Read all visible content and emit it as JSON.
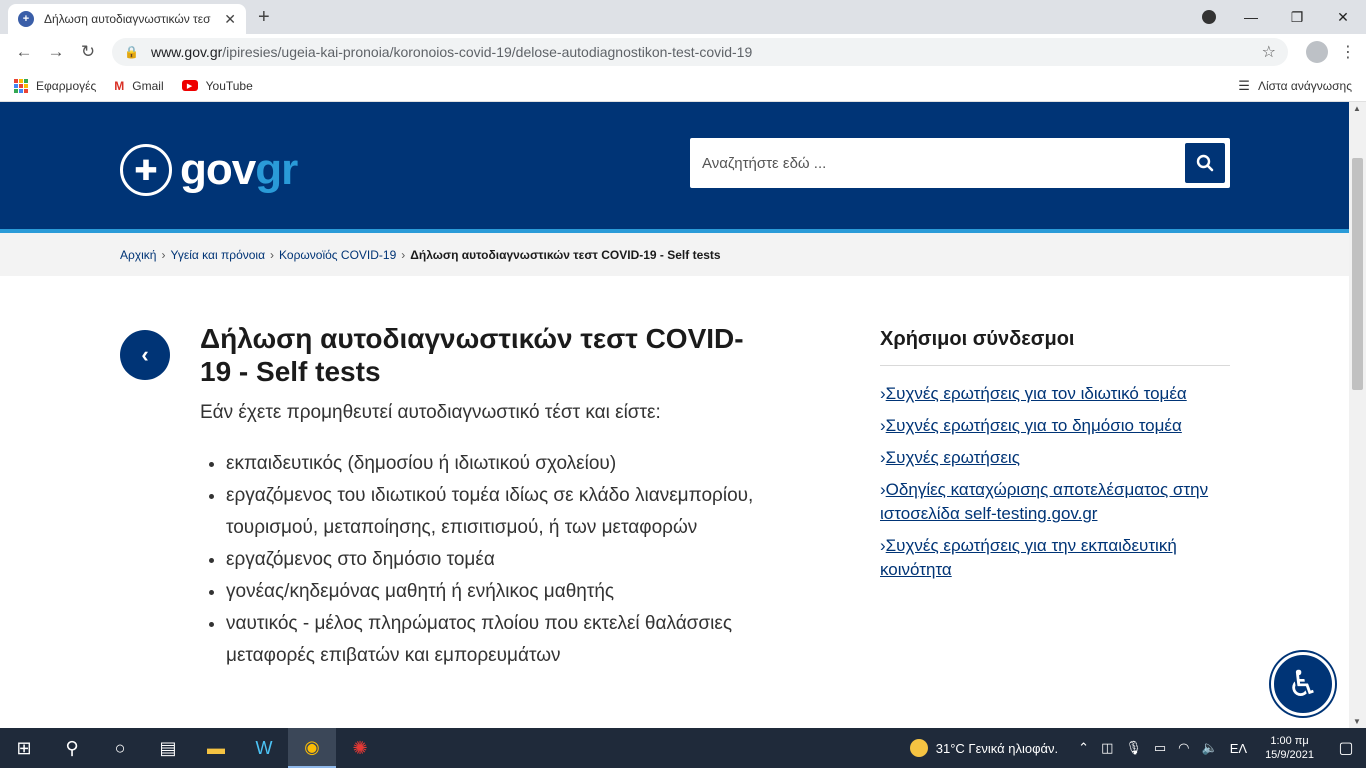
{
  "browser": {
    "tab_title": "Δήλωση αυτοδιαγνωστικών τεσ",
    "url_domain": "www.gov.gr",
    "url_path": "/ipiresies/ugeia-kai-pronoia/koronoios-covid-19/delose-autodiagnostikon-test-covid-19",
    "bookmarks": [
      "Εφαρμογές",
      "Gmail",
      "YouTube"
    ],
    "reading_list": "Λίστα ανάγνωσης"
  },
  "header": {
    "logo_gov": "gov",
    "logo_gr": "gr",
    "search_placeholder": "Αναζητήστε εδώ ..."
  },
  "breadcrumb": {
    "items": [
      "Αρχική",
      "Υγεία και πρόνοια",
      "Κορωνοϊός COVID-19"
    ],
    "current": "Δήλωση αυτοδιαγνωστικών τεστ COVID-19 - Self tests"
  },
  "main": {
    "title": "Δήλωση αυτοδιαγνωστικών τεστ COVID-19 - Self tests",
    "intro": "Εάν έχετε προμηθευτεί αυτοδιαγνωστικό τέστ και είστε:",
    "bullets": [
      "εκπαιδευτικός (δημοσίου ή ιδιωτικού σχολείου)",
      "εργαζόμενος του ιδιωτικού τομέα ιδίως σε κλάδο λιανεμπορίου, τουρισμού, μεταποίησης, επισιτισμού, ή των μεταφορών",
      "εργαζόμενος στο δημόσιο τομέα",
      "γονέας/κηδεμόνας μαθητή ή ενήλικος μαθητής",
      "ναυτικός - μέλος πληρώματος πλοίου που εκτελεί θαλάσσιες μεταφορές επιβατών και εμπορευμάτων"
    ]
  },
  "sidebar": {
    "title": "Χρήσιμοι σύνδεσμοι",
    "links": [
      "Συχνές ερωτήσεις για τον ιδιωτικό τομέα",
      "Συχνές ερωτήσεις για το δημόσιο τομέα",
      "Συχνές ερωτήσεις",
      "Οδηγίες καταχώρισης αποτελέσματος στην ιστοσελίδα self-testing.gov.gr",
      "Συχνές ερωτήσεις για την εκπαιδευτική κοινότητα"
    ]
  },
  "taskbar": {
    "weather": "31°C  Γενικά ηλιοφάν.",
    "lang": "ΕΛ",
    "time": "1:00 πμ",
    "date": "15/9/2021"
  }
}
